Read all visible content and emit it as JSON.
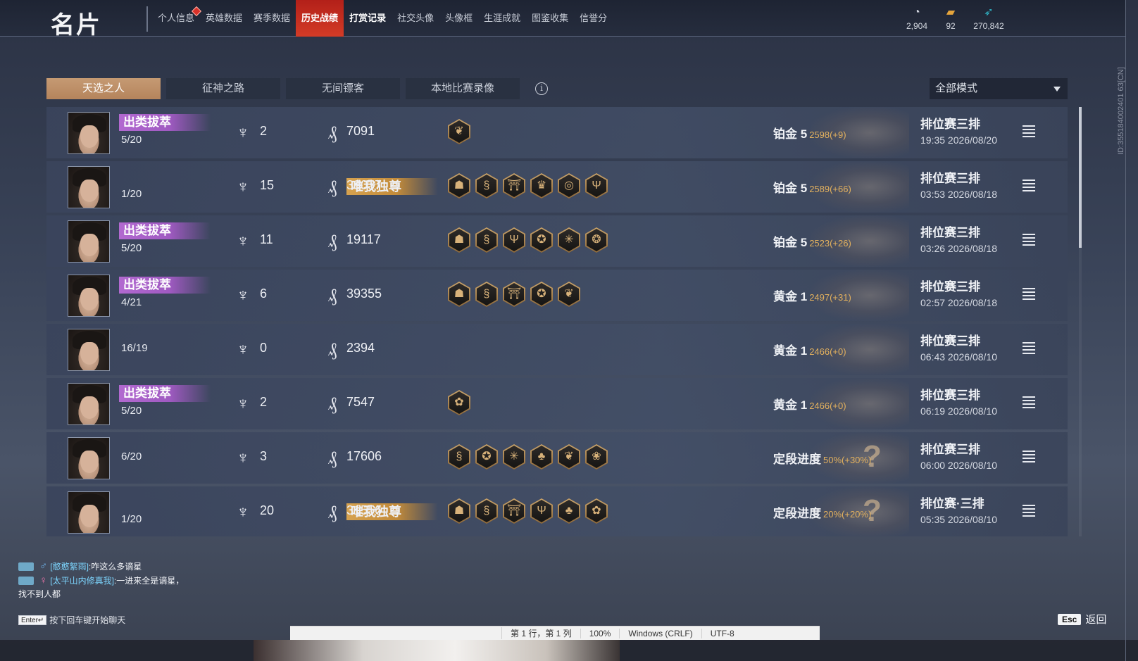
{
  "header": {
    "title": "名片",
    "nav": [
      {
        "label": "个人信息",
        "badge": true
      },
      {
        "label": "英雄数据"
      },
      {
        "label": "赛季数据"
      },
      {
        "label": "历史战绩",
        "active": true
      },
      {
        "label": "打赏记录",
        "bold": true
      },
      {
        "label": "社交头像"
      },
      {
        "label": "头像框"
      },
      {
        "label": "生涯成就"
      },
      {
        "label": "图鉴收集"
      },
      {
        "label": "信誉分"
      }
    ],
    "currencies": [
      {
        "icon": "coin-pile-icon",
        "value": "2,904"
      },
      {
        "icon": "ticket-icon",
        "value": "92"
      },
      {
        "icon": "feather-icon",
        "value": "270,842"
      }
    ],
    "side_id": "ID:355184002401 63[CN]"
  },
  "tabs": [
    "天选之人",
    "征神之路",
    "无间镖客",
    "本地比赛录像"
  ],
  "mode_select": "全部模式",
  "matches": [
    {
      "badge": "出类拔萃",
      "badge_color": "purple",
      "kda": "5/20",
      "kills": "2",
      "gold": "7091",
      "medals": [
        "wings-medal-icon"
      ],
      "tier": "铂金 5",
      "delta": "2598(+9)",
      "mode": "排位赛三排",
      "time": "19:35  2026/08/20",
      "deco": "spiral"
    },
    {
      "badge": "唯我独尊",
      "badge_color": "gold",
      "kda": "1/20",
      "kills": "15",
      "gold": "38037",
      "medals": [
        "mask-medal-icon",
        "snake-medal-icon",
        "gate-medal-icon",
        "crown-medal-icon",
        "spiral-medal-icon",
        "trident-medal-icon"
      ],
      "tier": "铂金 5",
      "delta": "2589(+66)",
      "mode": "排位赛三排",
      "time": "03:53  2026/08/18",
      "deco": "spiral"
    },
    {
      "badge": "出类拔萃",
      "badge_color": "purple",
      "kda": "5/20",
      "kills": "11",
      "gold": "19117",
      "medals": [
        "mask-medal-icon",
        "snake-medal-icon",
        "trident-medal-icon",
        "ring-medal-icon",
        "cross-medal-icon",
        "dragon-medal-icon"
      ],
      "tier": "铂金 5",
      "delta": "2523(+26)",
      "mode": "排位赛三排",
      "time": "03:26  2026/08/18",
      "deco": "spiral"
    },
    {
      "badge": "出类拔萃",
      "badge_color": "purple",
      "kda": "4/21",
      "kills": "6",
      "gold": "39355",
      "medals": [
        "mask-medal-icon",
        "snake-medal-icon",
        "gate-medal-icon",
        "ring-medal-icon",
        "wings-medal-icon"
      ],
      "tier": "黄金 1",
      "delta": "2497(+31)",
      "mode": "排位赛三排",
      "time": "02:57  2026/08/18",
      "deco": "spiral"
    },
    {
      "badge": "",
      "badge_color": "",
      "kda": "16/19",
      "kills": "0",
      "gold": "2394",
      "medals": [],
      "tier": "黄金 1",
      "delta": "2466(+0)",
      "mode": "排位赛三排",
      "time": "06:43  2026/08/10",
      "deco": "spiral"
    },
    {
      "badge": "出类拔萃",
      "badge_color": "purple",
      "kda": "5/20",
      "kills": "2",
      "gold": "7547",
      "medals": [
        "flower-medal-icon"
      ],
      "tier": "黄金 1",
      "delta": "2466(+0)",
      "mode": "排位赛三排",
      "time": "06:19  2026/08/10",
      "deco": "spiral"
    },
    {
      "badge": "",
      "badge_color": "",
      "kda": "6/20",
      "kills": "3",
      "gold": "17606",
      "medals": [
        "snake-medal-icon",
        "ring-medal-icon",
        "cross-medal-icon",
        "clover-medal-icon",
        "wings-medal-icon",
        "tree-medal-icon"
      ],
      "tier": "定段进度",
      "delta": "50%(+30%)",
      "mode": "排位赛三排",
      "time": "06:00  2026/08/10",
      "deco": "question"
    },
    {
      "badge": "唯我独尊",
      "badge_color": "gold",
      "kda": "1/20",
      "kills": "20",
      "gold": "31556",
      "medals": [
        "mask-medal-icon",
        "snake-medal-icon",
        "gate-medal-icon",
        "trident-medal-icon",
        "clover-medal-icon",
        "flower-medal-icon"
      ],
      "tier": "定段进度",
      "delta": "20%(+20%)",
      "mode": "排位赛·三排",
      "time": "05:35  2026/08/10",
      "deco": "question"
    }
  ],
  "chat": {
    "lines": [
      {
        "gender": "male",
        "name": "[憨憨絮雨]",
        "msg": ":咋这么多谪星"
      },
      {
        "gender": "female",
        "name": "[太平山内修真我]",
        "msg": ":一进来全是谪星，"
      }
    ],
    "wrap": "找不到人都",
    "enter_key": "Enter↵",
    "hint": "按下回车键开始聊天"
  },
  "esc": {
    "key": "Esc",
    "label": "返回"
  },
  "overlay_bar": [
    "第 1 行，第 1 列",
    "100%",
    "Windows (CRLF)",
    "UTF-8"
  ]
}
